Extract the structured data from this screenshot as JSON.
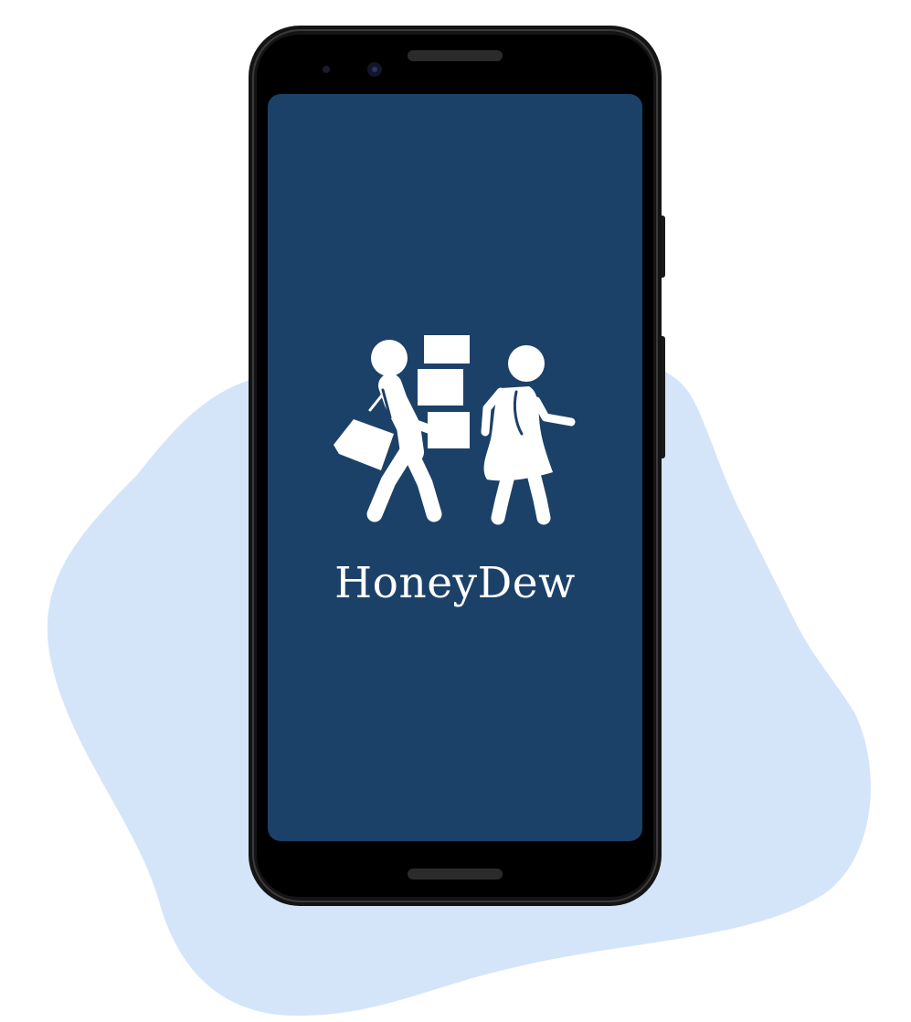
{
  "app": {
    "name": "HoneyDew",
    "splash_background": "#1c4169",
    "logo_color": "#ffffff",
    "logo_icon": "people-carrying-boxes-icon"
  },
  "device": {
    "frame_color": "#111111",
    "bezel_color": "#000000"
  },
  "backdrop": {
    "blob_color": "#d4e5fa"
  }
}
